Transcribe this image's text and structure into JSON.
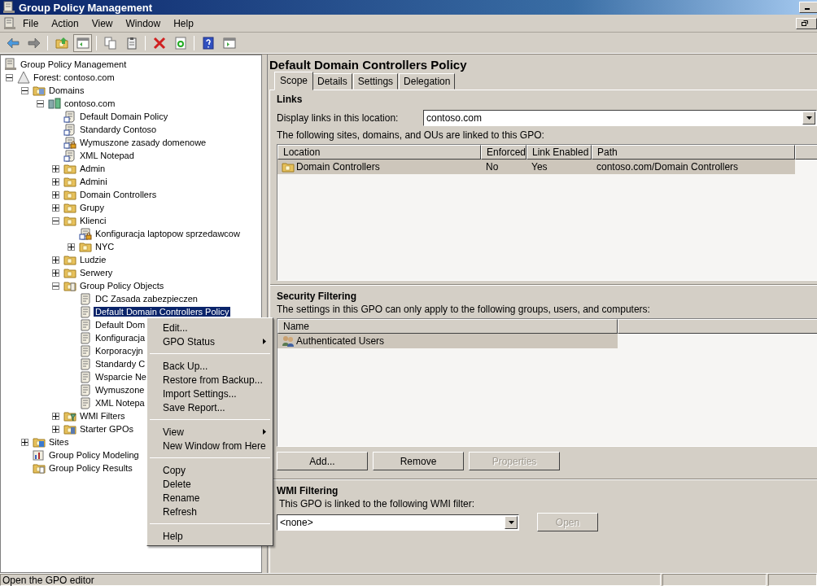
{
  "window": {
    "title": "Group Policy Management"
  },
  "menu_bar": [
    "File",
    "Action",
    "View",
    "Window",
    "Help"
  ],
  "toolbar": [
    {
      "kind": "back",
      "pressed": false
    },
    {
      "kind": "forward",
      "pressed": false
    },
    {
      "kind": "separator"
    },
    {
      "kind": "up",
      "pressed": false
    },
    {
      "kind": "tree",
      "pressed": true
    },
    {
      "kind": "separator"
    },
    {
      "kind": "copy",
      "pressed": false
    },
    {
      "kind": "paste",
      "pressed": false
    },
    {
      "kind": "separator"
    },
    {
      "kind": "delete",
      "pressed": false
    },
    {
      "kind": "refresh",
      "pressed": false
    },
    {
      "kind": "separator"
    },
    {
      "kind": "help",
      "pressed": false
    },
    {
      "kind": "action-pane",
      "pressed": false
    }
  ],
  "tree": {
    "root": {
      "label": "Group Policy Management",
      "selected": false
    },
    "items": [
      {
        "label": "Forest: contoso.com",
        "kind": "forest",
        "expanded": true,
        "selected": false,
        "children": [
          {
            "label": "Domains",
            "kind": "domains",
            "expanded": true,
            "selected": false,
            "children": [
              {
                "label": "contoso.com",
                "kind": "domain",
                "expanded": true,
                "selected": false,
                "children": [
                  {
                    "label": "Default Domain Policy",
                    "kind": "gpo-link",
                    "selected": false
                  },
                  {
                    "label": "Standardy Contoso",
                    "kind": "gpo-link",
                    "selected": false
                  },
                  {
                    "label": "Wymuszone zasady domenowe",
                    "kind": "gpo-link-enforced",
                    "selected": false
                  },
                  {
                    "label": "XML Notepad",
                    "kind": "gpo-link",
                    "selected": false
                  },
                  {
                    "label": "Admin",
                    "kind": "ou",
                    "expanded": false,
                    "selected": false
                  },
                  {
                    "label": "Admini",
                    "kind": "ou",
                    "expanded": false,
                    "selected": false
                  },
                  {
                    "label": "Domain Controllers",
                    "kind": "ou",
                    "expanded": false,
                    "selected": false
                  },
                  {
                    "label": "Grupy",
                    "kind": "ou",
                    "expanded": false,
                    "selected": false
                  },
                  {
                    "label": "Klienci",
                    "kind": "ou",
                    "expanded": true,
                    "selected": false,
                    "children": [
                      {
                        "label": "Konfiguracja laptopow sprzedawcow",
                        "kind": "gpo-link-enforced",
                        "selected": false
                      },
                      {
                        "label": "NYC",
                        "kind": "ou",
                        "expanded": false,
                        "selected": false
                      }
                    ]
                  },
                  {
                    "label": "Ludzie",
                    "kind": "ou",
                    "expanded": false,
                    "selected": false
                  },
                  {
                    "label": "Serwery",
                    "kind": "ou",
                    "expanded": false,
                    "selected": false
                  },
                  {
                    "label": "Group Policy Objects",
                    "kind": "gpo-container",
                    "expanded": true,
                    "selected": false,
                    "children": [
                      {
                        "label": "DC Zasada zabezpieczen",
                        "kind": "gpo",
                        "selected": false
                      },
                      {
                        "label": "Default Domain Controllers Policy",
                        "kind": "gpo",
                        "selected": true
                      },
                      {
                        "label": "Default Dom",
                        "kind": "gpo",
                        "selected": false
                      },
                      {
                        "label": "Konfiguracja",
                        "kind": "gpo",
                        "selected": false
                      },
                      {
                        "label": "Korporacyjn",
                        "kind": "gpo",
                        "selected": false
                      },
                      {
                        "label": "Standardy C",
                        "kind": "gpo",
                        "selected": false
                      },
                      {
                        "label": "Wsparcie Ne",
                        "kind": "gpo",
                        "selected": false
                      },
                      {
                        "label": "Wymuszone",
                        "kind": "gpo",
                        "selected": false
                      },
                      {
                        "label": "XML Notepa",
                        "kind": "gpo",
                        "selected": false
                      }
                    ]
                  },
                  {
                    "label": "WMI Filters",
                    "kind": "wmi",
                    "expanded": false,
                    "selected": false
                  },
                  {
                    "label": "Starter GPOs",
                    "kind": "starter",
                    "expanded": false,
                    "selected": false
                  }
                ]
              }
            ]
          },
          {
            "label": "Sites",
            "kind": "sites",
            "expanded": false,
            "selected": false
          },
          {
            "label": "Group Policy Modeling",
            "kind": "modeling",
            "selected": false
          },
          {
            "label": "Group Policy Results",
            "kind": "results",
            "selected": false
          }
        ]
      }
    ]
  },
  "context_menu": [
    {
      "kind": "item",
      "label": "Edit..."
    },
    {
      "kind": "submenu",
      "label": "GPO Status"
    },
    {
      "kind": "separator"
    },
    {
      "kind": "item",
      "label": "Back Up..."
    },
    {
      "kind": "item",
      "label": "Restore from Backup..."
    },
    {
      "kind": "item",
      "label": "Import Settings..."
    },
    {
      "kind": "item",
      "label": "Save Report..."
    },
    {
      "kind": "separator"
    },
    {
      "kind": "submenu",
      "label": "View"
    },
    {
      "kind": "item",
      "label": "New Window from Here"
    },
    {
      "kind": "separator"
    },
    {
      "kind": "item",
      "label": "Copy"
    },
    {
      "kind": "item",
      "label": "Delete"
    },
    {
      "kind": "item",
      "label": "Rename"
    },
    {
      "kind": "item",
      "label": "Refresh"
    },
    {
      "kind": "separator"
    },
    {
      "kind": "item",
      "label": "Help"
    }
  ],
  "details": {
    "title": "Default Domain Controllers Policy",
    "tabs": [
      {
        "label": "Scope",
        "selected": true
      },
      {
        "label": "Details",
        "selected": false
      },
      {
        "label": "Settings",
        "selected": false
      },
      {
        "label": "Delegation",
        "selected": false
      }
    ],
    "links": {
      "heading": "Links",
      "location_label": "Display links in this location:",
      "location_value": "contoso.com",
      "description": "The following sites, domains, and OUs are linked to this GPO:",
      "columns": [
        "Location",
        "Enforced",
        "Link Enabled",
        "Path"
      ],
      "rows": [
        {
          "cells": [
            "Domain Controllers",
            "No",
            "Yes",
            "contoso.com/Domain Controllers"
          ],
          "selected": true
        }
      ]
    },
    "security_filtering": {
      "heading": "Security Filtering",
      "description": "The settings in this GPO can only apply to the following groups, users, and computers:",
      "columns": [
        "Name"
      ],
      "rows": [
        {
          "cells": [
            "Authenticated Users"
          ],
          "selected": true
        }
      ],
      "buttons": [
        {
          "label": "Add...",
          "disabled": false
        },
        {
          "label": "Remove",
          "disabled": false
        },
        {
          "label": "Properties",
          "disabled": true
        }
      ]
    },
    "wmi_filtering": {
      "heading": "WMI Filtering",
      "description": "This GPO is linked to the following WMI filter:",
      "filter_value": "<none>",
      "button": {
        "label": "Open",
        "disabled": true
      }
    }
  },
  "status_bar": {
    "text": "Open the GPO editor"
  }
}
